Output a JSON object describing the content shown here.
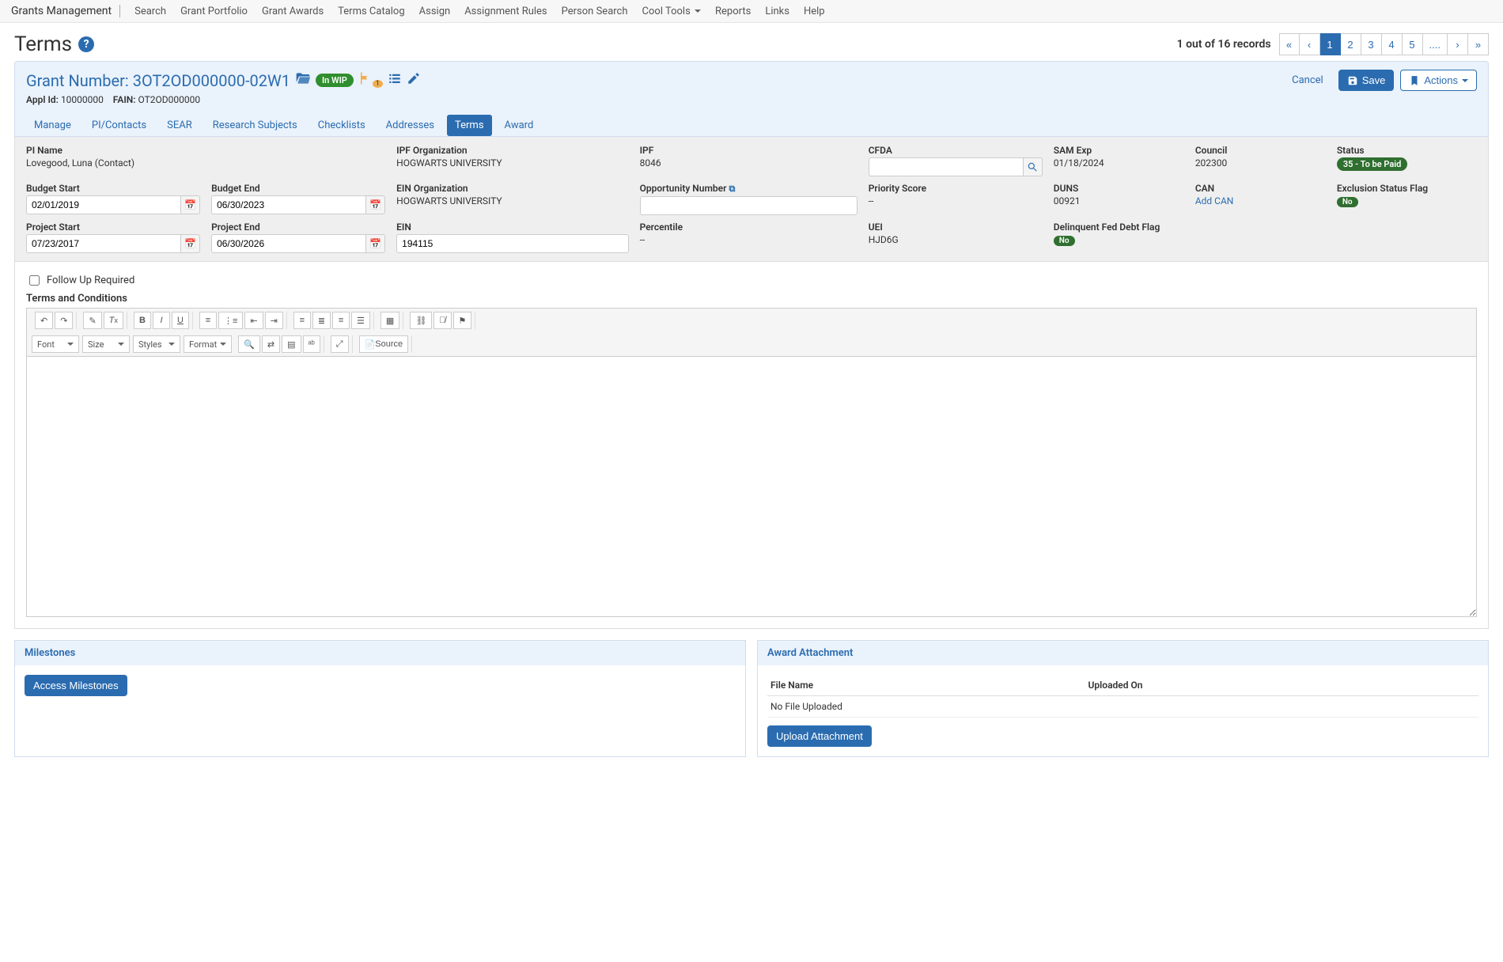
{
  "nav": {
    "brand": "Grants Management",
    "items": [
      "Search",
      "Grant Portfolio",
      "Grant Awards",
      "Terms Catalog",
      "Assign",
      "Assignment Rules",
      "Person Search",
      "Cool Tools",
      "Reports",
      "Links",
      "Help"
    ]
  },
  "page": {
    "title": "Terms",
    "records_text": "1 out of 16 records",
    "pager": [
      "1",
      "2",
      "3",
      "4",
      "5",
      "...."
    ]
  },
  "header": {
    "grant_label": "Grant Number:",
    "grant_number": "3OT2OD000000-02W1",
    "wip_badge": "In WIP",
    "flag_count": "1",
    "cancel": "Cancel",
    "save": "Save",
    "actions": "Actions",
    "appl_id_label": "Appl Id:",
    "appl_id": "10000000",
    "fain_label": "FAIN:",
    "fain": "OT2OD000000"
  },
  "tabs": [
    "Manage",
    "PI/Contacts",
    "SEAR",
    "Research Subjects",
    "Checklists",
    "Addresses",
    "Terms",
    "Award"
  ],
  "active_tab": "Terms",
  "info": {
    "pi_name_label": "PI Name",
    "pi_name": "Lovegood, Luna (Contact)",
    "ipf_org_label": "IPF Organization",
    "ipf_org": "HOGWARTS UNIVERSITY",
    "ipf_label": "IPF",
    "ipf": "8046",
    "cfda_label": "CFDA",
    "cfda": "",
    "sam_exp_label": "SAM Exp",
    "sam_exp": "01/18/2024",
    "council_label": "Council",
    "council": "202300",
    "status_label": "Status",
    "status_badge": "35 - To be Paid",
    "budget_start_label": "Budget Start",
    "budget_start": "02/01/2019",
    "budget_end_label": "Budget End",
    "budget_end": "06/30/2023",
    "ein_org_label": "EIN Organization",
    "ein_org": "HOGWARTS UNIVERSITY",
    "opp_num_label": "Opportunity Number",
    "opp_num": "",
    "priority_label": "Priority Score",
    "priority": "--",
    "duns_label": "DUNS",
    "duns": "00921",
    "can_label": "CAN",
    "add_can": "Add CAN",
    "excl_label": "Exclusion Status Flag",
    "excl_badge": "No",
    "proj_start_label": "Project Start",
    "proj_start": "07/23/2017",
    "proj_end_label": "Project End",
    "proj_end": "06/30/2026",
    "ein_label": "EIN",
    "ein": "194115",
    "percentile_label": "Percentile",
    "percentile": "--",
    "uei_label": "UEI",
    "uei": "HJD6G",
    "delinq_label": "Delinquent Fed Debt Flag",
    "delinq_badge": "No"
  },
  "editor": {
    "followup_label": "Follow Up Required",
    "section_title": "Terms and Conditions",
    "selectors": {
      "font": "Font",
      "size": "Size",
      "styles": "Styles",
      "format": "Format"
    },
    "source": "Source"
  },
  "milestones": {
    "title": "Milestones",
    "button": "Access Milestones"
  },
  "attachment": {
    "title": "Award Attachment",
    "cols": {
      "file": "File Name",
      "uploaded": "Uploaded On"
    },
    "empty": "No File Uploaded",
    "upload_btn": "Upload Attachment"
  }
}
